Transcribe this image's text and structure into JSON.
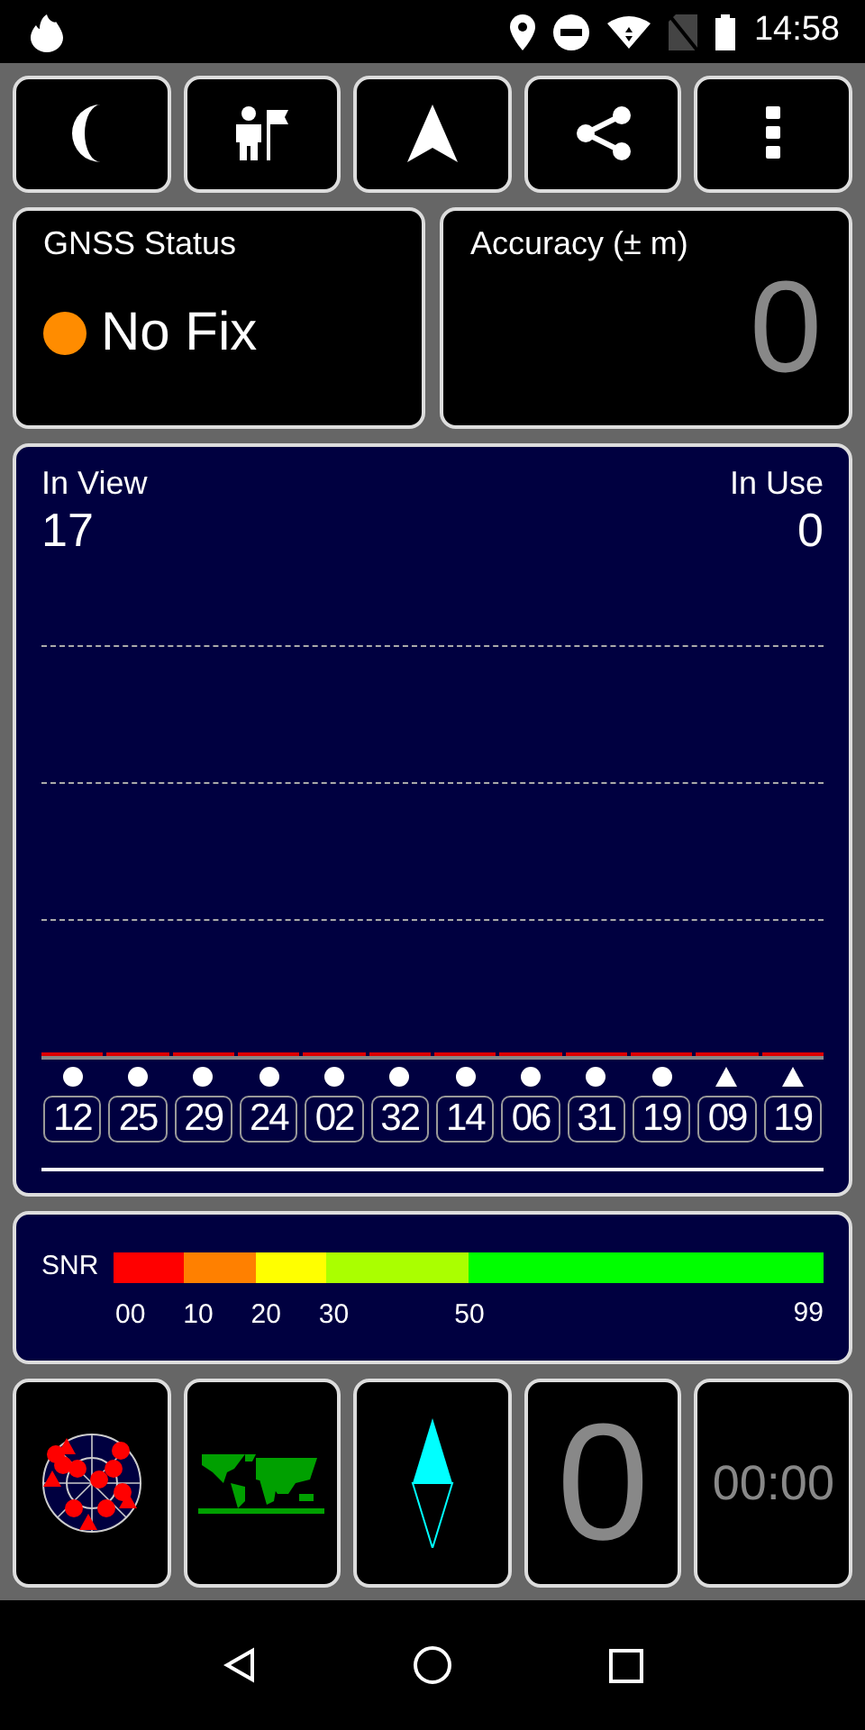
{
  "status_bar": {
    "time": "14:58"
  },
  "toolbar": [
    {
      "kind": "moon"
    },
    {
      "kind": "person-flag"
    },
    {
      "kind": "arrow"
    },
    {
      "kind": "share"
    },
    {
      "kind": "more"
    }
  ],
  "gnss_status": {
    "title": "GNSS Status",
    "value": "No Fix",
    "color": "#ff8c00"
  },
  "accuracy": {
    "title": "Accuracy (± m)",
    "value": "0"
  },
  "sky": {
    "in_view_label": "In View",
    "in_view": "17",
    "in_use_label": "In Use",
    "in_use": "0",
    "satellites": [
      {
        "id": "12",
        "kind": "circle"
      },
      {
        "id": "25",
        "kind": "circle"
      },
      {
        "id": "29",
        "kind": "circle"
      },
      {
        "id": "24",
        "kind": "circle"
      },
      {
        "id": "02",
        "kind": "circle"
      },
      {
        "id": "32",
        "kind": "circle"
      },
      {
        "id": "14",
        "kind": "circle"
      },
      {
        "id": "06",
        "kind": "circle"
      },
      {
        "id": "31",
        "kind": "circle"
      },
      {
        "id": "19",
        "kind": "circle"
      },
      {
        "id": "09",
        "kind": "triangle"
      },
      {
        "id": "19",
        "kind": "triangle"
      }
    ]
  },
  "snr": {
    "label": "SNR",
    "segments": [
      {
        "color": "#ff0000",
        "label": "00"
      },
      {
        "color": "#ff8000",
        "label": "10"
      },
      {
        "color": "#ffff00",
        "label": "20"
      },
      {
        "color": "#aaff00",
        "label": "30"
      },
      {
        "color": "#00ff00",
        "label": "50"
      }
    ],
    "max_label": "99"
  },
  "tiles": [
    {
      "kind": "radar"
    },
    {
      "kind": "map"
    },
    {
      "kind": "compass"
    },
    {
      "kind": "number",
      "text": "0"
    },
    {
      "kind": "timer",
      "text": "00:00"
    }
  ]
}
